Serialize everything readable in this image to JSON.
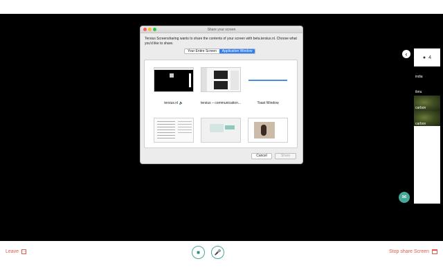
{
  "dialog": {
    "title": "Share your screen",
    "message": "Tersius Screensharing wants to share the contents of your screen with beta.tersius.nl. Choose what you'd like to share.",
    "tabs": [
      "Your Entire Screen",
      "Application Window"
    ],
    "active_tab": "Application Window",
    "windows": [
      {
        "label": "tersius.nl 🔈"
      },
      {
        "label": "tersius – communication..."
      },
      {
        "label": "Toast Window"
      },
      {
        "label": ""
      },
      {
        "label": ""
      },
      {
        "label": ""
      }
    ],
    "cancel_label": "Cancel",
    "share_label": "Share"
  },
  "sidebar": {
    "toggle_icon": "chevron-left-icon",
    "participant_count": "4",
    "participants": [
      "india",
      "ibnu",
      "carbon",
      "carbon"
    ]
  },
  "bottombar": {
    "leave_label": "Leave",
    "stop_share_label": "Stop share Screen",
    "accent": "#e05a4a",
    "control_color": "#47a89a"
  }
}
